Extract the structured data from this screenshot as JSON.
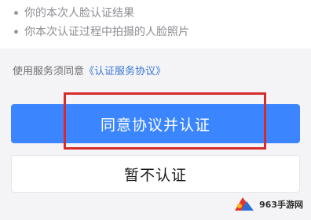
{
  "info": {
    "bullets": [
      "你的本次人脸认证结果",
      "你本次认证过程中拍摄的人脸照片"
    ]
  },
  "consent": {
    "prefix": "使用服务须同意",
    "agreement_link": "《认证服务协议》"
  },
  "buttons": {
    "agree": "同意协议并认证",
    "decline": "暂不认证"
  },
  "colors": {
    "primary": "#3b86ff",
    "highlight": "#d72a2a",
    "link": "#3a78d6"
  },
  "watermark": {
    "text": "963手游网"
  }
}
